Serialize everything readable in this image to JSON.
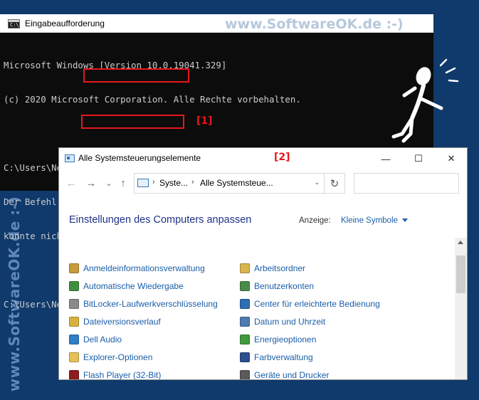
{
  "watermark": {
    "top": "www.SoftwareOK.de :-)",
    "side": "www.SoftwareOK.de :-)"
  },
  "cmd": {
    "title": "Eingabeaufforderung",
    "icon_text": "C:\\",
    "lines": [
      "Microsoft Windows [Version 10.0.19041.329]",
      "(c) 2020 Microsoft Corporation. Alle Rechte vorbehalten.",
      "",
      "C:\\Users\\Nenad>wichtige sachen",
      "Der Befehl \"wichtige\" ist entweder falsch geschrieben oder",
      "konnte nicht gefunden werden.",
      "",
      "C:\\Users\\Nenad>control"
    ],
    "marker": "[1]"
  },
  "controlpanel": {
    "title": "Alle Systemsteuerungselemente",
    "marker": "[2]",
    "window_buttons": {
      "minimize": "—",
      "maximize": "☐",
      "close": "✕"
    },
    "nav": {
      "back": "←",
      "forward": "→",
      "recent": "⌄",
      "up": "↑",
      "refresh": "↻"
    },
    "breadcrumb": [
      "Syste...",
      "Alle Systemsteue..."
    ],
    "breadcrumb_sep": "›",
    "breadcrumb_drop": "⌄",
    "search_placeholder": "",
    "heading": "Einstellungen des Computers anpassen",
    "view_label": "Anzeige:",
    "view_value": "Kleine Symbole",
    "items_left": [
      {
        "label": "Anmeldeinformationsverwaltung",
        "icon": "credential-manager-icon",
        "color": "#c79a3a"
      },
      {
        "label": "Automatische Wiedergabe",
        "icon": "autoplay-icon",
        "color": "#3f8f3f"
      },
      {
        "label": "BitLocker-Laufwerkverschlüsselung",
        "icon": "bitlocker-icon",
        "color": "#8a8a8a"
      },
      {
        "label": "Dateiversionsverlauf",
        "icon": "file-history-icon",
        "color": "#d8b23c"
      },
      {
        "label": "Dell Audio",
        "icon": "dell-audio-icon",
        "color": "#2f7fc9"
      },
      {
        "label": "Explorer-Optionen",
        "icon": "explorer-options-icon",
        "color": "#e5c15a"
      },
      {
        "label": "Flash Player (32-Bit)",
        "icon": "flash-player-icon",
        "color": "#8e1c1c"
      }
    ],
    "items_right": [
      {
        "label": "Arbeitsordner",
        "icon": "work-folders-icon",
        "color": "#d9b550"
      },
      {
        "label": "Benutzerkonten",
        "icon": "user-accounts-icon",
        "color": "#4a8a4a"
      },
      {
        "label": "Center für erleichterte Bedienung",
        "icon": "ease-of-access-icon",
        "color": "#2d6fb4"
      },
      {
        "label": "Datum und Uhrzeit",
        "icon": "date-time-icon",
        "color": "#4d7bb0"
      },
      {
        "label": "Energieoptionen",
        "icon": "power-options-icon",
        "color": "#3e9a3e"
      },
      {
        "label": "Farbverwaltung",
        "icon": "color-management-icon",
        "color": "#2b4f8f"
      },
      {
        "label": "Geräte und Drucker",
        "icon": "devices-printers-icon",
        "color": "#5a5a5a"
      }
    ]
  }
}
